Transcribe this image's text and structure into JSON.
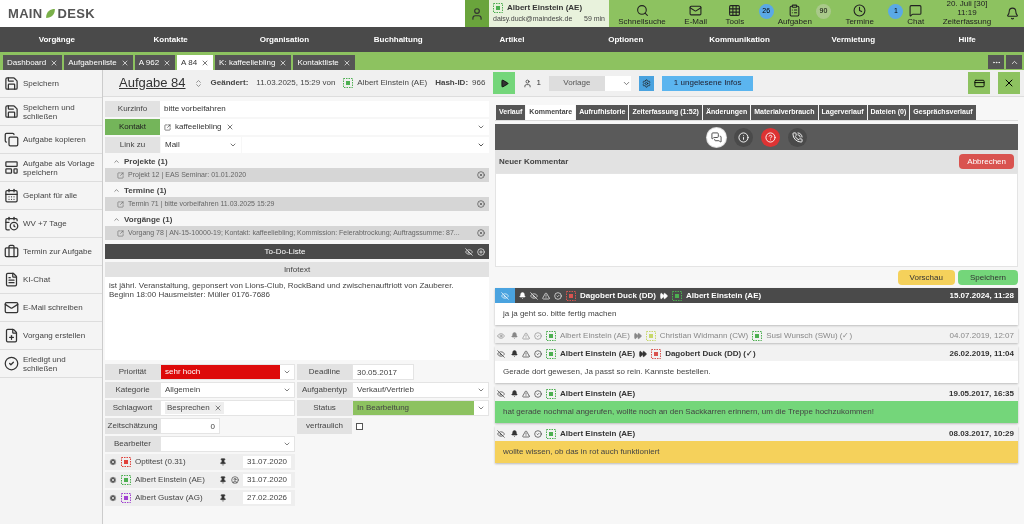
{
  "header": {
    "logo": [
      "MAIN",
      "DESK"
    ],
    "user": {
      "name": "Albert Einstein (AE)",
      "email": "daisy.duck@maindesk.de",
      "session": "59 min"
    },
    "tools": [
      {
        "kind": "search",
        "label": "Schnellsuche"
      },
      {
        "kind": "mail",
        "label": "E-Mail"
      },
      {
        "kind": "grid",
        "label": "Tools"
      },
      {
        "kind": "tasks",
        "label": "Aufgaben",
        "badges": [
          {
            "text": "26",
            "color": "#5aa9e6"
          },
          {
            "text": "90",
            "color": "#a9c98a"
          }
        ]
      },
      {
        "kind": "clock",
        "label": "Termine"
      },
      {
        "kind": "chat",
        "label": "Chat",
        "badges": [
          {
            "text": "1",
            "color": "#5aa9e6"
          }
        ]
      },
      {
        "kind": "time",
        "label": "Zeiterfassung",
        "lines": [
          "20. Juli [30]",
          "11:19"
        ]
      }
    ]
  },
  "nav": [
    "Vorgänge",
    "Kontakte",
    "Organisation",
    "Buchhaltung",
    "Artikel",
    "Optionen",
    "Kommunikation",
    "Vermietung",
    "Hilfe"
  ],
  "tabs": [
    {
      "label": "Dashboard",
      "selected": false
    },
    {
      "label": "Aufgabenliste",
      "selected": false
    },
    {
      "label": "A 962",
      "selected": false
    },
    {
      "label": "A 84",
      "selected": true
    },
    {
      "label": "K: kaffeeliebling",
      "selected": false
    },
    {
      "label": "Kontaktliste",
      "selected": false
    }
  ],
  "title": {
    "heading": "Aufgabe 84",
    "changed_label": "Geändert:",
    "changed": "11.03.2025, 15:29 von",
    "user": {
      "name": "Albert Einstein (AE)",
      "color": "#4caf50"
    },
    "hash_label": "Hash-ID:",
    "hash": "966",
    "count": "1",
    "template": "Vorlage",
    "infos": "1 ungelesene Infos"
  },
  "sidebar": [
    {
      "kind": "save",
      "label": "Speichern"
    },
    {
      "kind": "save",
      "label": "Speichern und schließen"
    },
    {
      "kind": "copy",
      "label": "Aufgabe kopieren"
    },
    {
      "kind": "template",
      "label": "Aufgabe als Vorlage speichern"
    },
    {
      "kind": "calendar",
      "label": "Geplant für alle"
    },
    {
      "kind": "recur",
      "label": "WV +7 Tage"
    },
    {
      "kind": "briefcase",
      "label": "Termin zur Aufgabe"
    },
    {
      "kind": "doc",
      "label": "KI-Chat"
    },
    {
      "kind": "mail",
      "label": "E-Mail schreiben"
    },
    {
      "kind": "newdoc",
      "label": "Vorgang erstellen"
    },
    {
      "kind": "done",
      "label": "Erledigt und schließen"
    }
  ],
  "form": {
    "kurzinfo": {
      "label": "Kurzinfo",
      "value": "bitte vorbeifahren"
    },
    "kontakt": {
      "label": "Kontakt",
      "chip": "kaffeeliebling"
    },
    "link": {
      "label": "Link zu",
      "value": "Mail"
    },
    "groups": [
      {
        "title": "Projekte (1)",
        "expanded": true,
        "items": [
          "Projekt 12 | EAS Seminar: 01.01.2020"
        ]
      },
      {
        "title": "Termine (1)",
        "expanded": true,
        "items": [
          "Termin 71 | bitte vorbeifahren 11.03.2025 15:29"
        ]
      },
      {
        "title": "Vorgänge (1)",
        "expanded": true,
        "items": [
          "Vorgang 78 | AN-15-10000-19; Kontakt: kaffeeliebling; Kommission: Feierabtrockung; Auftragssumme: 87..."
        ]
      }
    ],
    "todo": "To-Do-Liste",
    "infotext": {
      "title": "Infotext",
      "value": "ist jährl. Veranstaltung, geponsert von Lions-Club, RockBand und zwischenauftriott von Zauberer.\nBeginn 18:00 Hausmeister: Müller 0176-7686"
    },
    "left": [
      {
        "kind": "select",
        "label": "Priorität",
        "value": "sehr hoch",
        "color": "#dd0a0a"
      },
      {
        "kind": "select",
        "label": "Kategorie",
        "value": "Allgemein"
      },
      {
        "kind": "chips",
        "label": "Schlagwort",
        "value": "Besprechen"
      },
      {
        "kind": "number",
        "label": "Zeitschätzung",
        "value": "0"
      },
      {
        "kind": "select",
        "label": "Bearbeiter"
      }
    ],
    "right": [
      {
        "kind": "date",
        "label": "Deadline",
        "value": "30.05.2017"
      },
      {
        "kind": "select",
        "label": "Aufgabentyp",
        "value": "Verkauf/Vertrieb"
      },
      {
        "kind": "select",
        "label": "Status",
        "value": "In Bearbeitung",
        "color": "#8dc260"
      },
      {
        "kind": "checkbox",
        "label": "vertraulich",
        "checked": false
      }
    ],
    "assignees": [
      {
        "name": "Optitest (0.31)",
        "color": "#e0403a",
        "notify": false,
        "date": "31.07.2020"
      },
      {
        "name": "Albert Einstein (AE)",
        "color": "#4caf50",
        "notify": true,
        "date": "31.07.2020"
      },
      {
        "name": "Albert Gustav (AG)",
        "color": "#a040d0",
        "notify": false,
        "date": "27.02.2026"
      }
    ]
  },
  "panel": {
    "tabs": [
      {
        "label": "Verlauf",
        "selected": false
      },
      {
        "label": "Kommentare",
        "selected": true
      },
      {
        "label": "Aufrufhistorie",
        "selected": false
      },
      {
        "label": "Zeiterfassung (1:52)",
        "selected": false
      },
      {
        "label": "Änderungen",
        "selected": false
      },
      {
        "label": "Materialverbrauch",
        "selected": false
      },
      {
        "label": "Lagerverlauf",
        "selected": false
      },
      {
        "label": "Dateien (0)",
        "selected": false
      },
      {
        "label": "Gesprächsverlauf",
        "selected": false
      }
    ],
    "modes": [
      {
        "kind": "comments",
        "selected": true
      },
      {
        "kind": "info",
        "selected": false
      },
      {
        "kind": "question",
        "selected": false
      },
      {
        "kind": "call",
        "selected": false
      }
    ],
    "new_comment": {
      "title": "Neuer Kommentar",
      "cancel": "Abbrechen",
      "preview": "Vorschau",
      "save": "Speichern"
    },
    "comments": [
      {
        "highlighted": true,
        "seen": false,
        "muted": false,
        "from": {
          "name": "Dagobert Duck (DD)",
          "color": "#d9534f"
        },
        "to": [
          {
            "name": "Albert Einstein (AE)",
            "color": "#4caf50"
          }
        ],
        "date": "15.07.2024, 11:28",
        "body": "ja ja geht so. bitte fertig machen",
        "color": "#ffffff"
      },
      {
        "highlighted": false,
        "seen": true,
        "muted": true,
        "from": {
          "name": "Albert Einstein (AE)",
          "color": "#4caf50"
        },
        "to": [
          {
            "name": "Christian Widmann (CW)",
            "color": "#c8d86a"
          },
          {
            "name": "Susi Wunsch (SWu) (✓)",
            "color": "#4caf50"
          }
        ],
        "date": "04.07.2019, 12:07"
      },
      {
        "highlighted": false,
        "seen": false,
        "muted": false,
        "from": {
          "name": "Albert Einstein (AE)",
          "color": "#4caf50"
        },
        "to": [
          {
            "name": "Dagobert Duck (DD) (✓)",
            "color": "#d9534f"
          }
        ],
        "date": "26.02.2019, 11:04",
        "body": "Gerade dort gewesen, Ja passt so rein. Kannste bestellen.",
        "color": "#ffffff"
      },
      {
        "highlighted": false,
        "seen": false,
        "muted": false,
        "from": {
          "name": "Albert Einstein (AE)",
          "color": "#4caf50"
        },
        "date": "19.05.2017, 16:35",
        "body": "hat gerade nochmal angerufen, wollte noch an den Sackkarren erinnern, um die Treppe hochzukommen!",
        "color": "#74d67a"
      },
      {
        "highlighted": false,
        "seen": false,
        "muted": false,
        "from": {
          "name": "Albert Einstein (AE)",
          "color": "#4caf50"
        },
        "date": "08.03.2017, 10:29",
        "body": "wollte wissen, ob das in rot auch funktioniert",
        "color": "#f5d15b"
      }
    ]
  }
}
